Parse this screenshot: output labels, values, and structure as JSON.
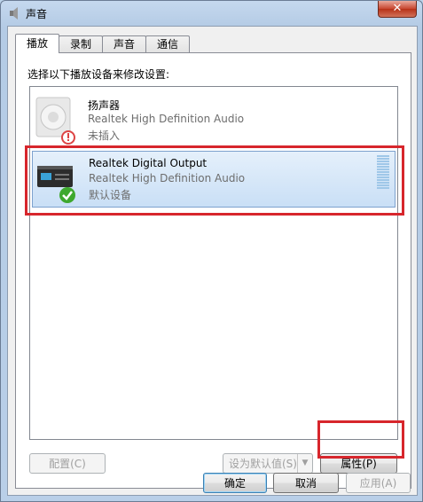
{
  "window": {
    "title": "声音",
    "close_glyph": "✕"
  },
  "tabs": [
    {
      "label": "播放",
      "active": true
    },
    {
      "label": "录制",
      "active": false
    },
    {
      "label": "声音",
      "active": false
    },
    {
      "label": "通信",
      "active": false
    }
  ],
  "playback": {
    "instruction": "选择以下播放设备来修改设置:",
    "devices": [
      {
        "name": "扬声器",
        "description": "Realtek High Definition Audio",
        "status": "未插入",
        "icon": "speaker-icon",
        "selected": false
      },
      {
        "name": "Realtek Digital Output",
        "description": "Realtek High Definition Audio",
        "status": "默认设备",
        "icon": "digital-output-icon",
        "selected": true
      }
    ],
    "configure_label": "配置(C)",
    "set_default_label": "设为默认值(S)",
    "properties_label": "属性(P)"
  },
  "dialog": {
    "ok_label": "确定",
    "cancel_label": "取消",
    "apply_label": "应用(A)"
  },
  "colors": {
    "highlight": "#d7262c",
    "selection": "#c9dff6"
  }
}
